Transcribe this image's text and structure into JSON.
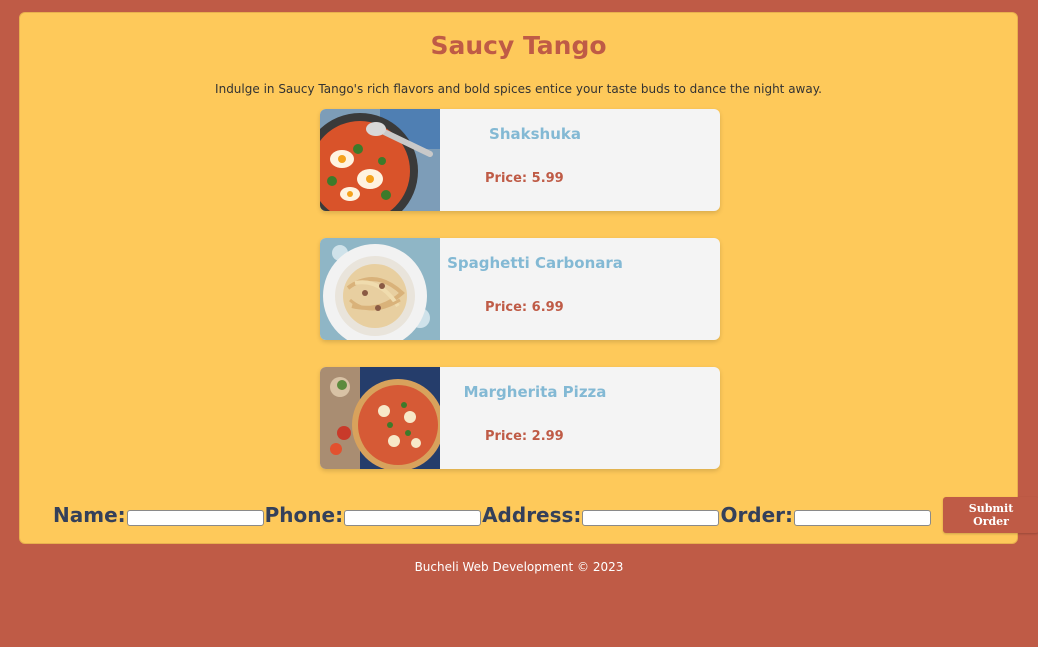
{
  "page": {
    "title": "Saucy Tango",
    "intro": "Indulge in Saucy Tango's rich flavors and bold spices entice your taste buds to dance the night away."
  },
  "menu": {
    "items": [
      {
        "name": "Shakshuka",
        "price": "Price: 5.99",
        "photo": "shakshuka-photo"
      },
      {
        "name": "Spaghetti Carbonara",
        "price": "Price: 6.99",
        "photo": "carbonara-photo"
      },
      {
        "name": "Margherita Pizza",
        "price": "Price: 2.99",
        "photo": "pizza-photo"
      }
    ]
  },
  "form": {
    "name_label": "Name:",
    "phone_label": "Phone:",
    "address_label": "Address:",
    "order_label": "Order:",
    "name_value": "",
    "phone_value": "",
    "address_value": "",
    "order_value": "",
    "submit_label": "Submit Order"
  },
  "footer": {
    "text": "Bucheli Web Development © 2023"
  },
  "colors": {
    "background": "#bf5b46",
    "card": "#fec95a",
    "title": "#bf5b46",
    "dish_name": "#83b9d4",
    "price": "#bf5b46",
    "form_label": "#34405a"
  }
}
